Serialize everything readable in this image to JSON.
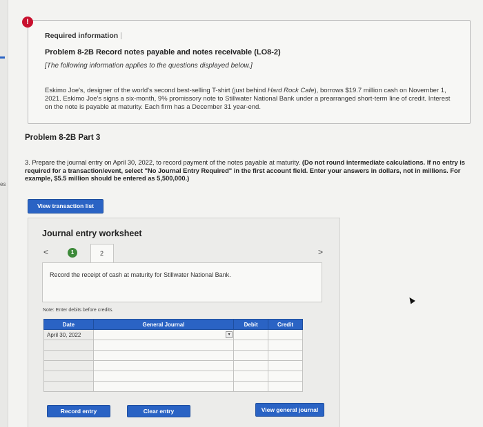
{
  "sidebar": {
    "fragment": "es"
  },
  "alert": {
    "icon": "exclamation-icon",
    "glyph": "!"
  },
  "info": {
    "heading": "Required information",
    "problem_title": "Problem 8-2B Record notes payable and notes receivable (LO8-2)",
    "note": "[The following information applies to the questions displayed below.]",
    "body_parts": [
      "Eskimo Joe's, designer of the world's second best-selling T-shirt (just behind ",
      "Hard Rock Cafe",
      "), borrows $19.7 million cash on November 1, 2021. Eskimo Joe's signs a six-month, 9% promissory note to Stillwater National Bank under a prearranged short-term line of credit. Interest on the note is payable at maturity. Each firm has a December 31 year-end."
    ]
  },
  "part": {
    "title": "Problem 8-2B Part 3"
  },
  "question": {
    "text": "3. Prepare the journal entry on April 30, 2022, to record payment of the notes payable at maturity. ",
    "instruction": "(Do not round intermediate calculations. If no entry is required for a transaction/event, select \"No Journal Entry Required\" in the first account field. Enter your answers in dollars, not in millions. For example, $5.5 million should be entered as 5,500,000.)"
  },
  "buttons": {
    "view_transactions": "View transaction list",
    "record_entry": "Record entry",
    "clear_entry": "Clear entry",
    "view_general_journal": "View general journal"
  },
  "worksheet": {
    "title": "Journal entry worksheet",
    "nav_prev": "<",
    "nav_next": ">",
    "steps": [
      "1",
      "2"
    ],
    "current_step": "2",
    "instruction": "Record the receipt of cash at maturity for Stillwater National Bank.",
    "note": "Note: Enter debits before credits.",
    "table": {
      "headers": [
        "Date",
        "General Journal",
        "Debit",
        "Credit"
      ],
      "rows": [
        {
          "date": "April 30, 2022",
          "account": "",
          "debit": "",
          "credit": ""
        },
        {
          "date": "",
          "account": "",
          "debit": "",
          "credit": ""
        },
        {
          "date": "",
          "account": "",
          "debit": "",
          "credit": ""
        },
        {
          "date": "",
          "account": "",
          "debit": "",
          "credit": ""
        },
        {
          "date": "",
          "account": "",
          "debit": "",
          "credit": ""
        },
        {
          "date": "",
          "account": "",
          "debit": "",
          "credit": ""
        }
      ]
    }
  },
  "colors": {
    "primary": "#2a63c4",
    "alert": "#c8102e",
    "step_done": "#3d8a3a"
  }
}
